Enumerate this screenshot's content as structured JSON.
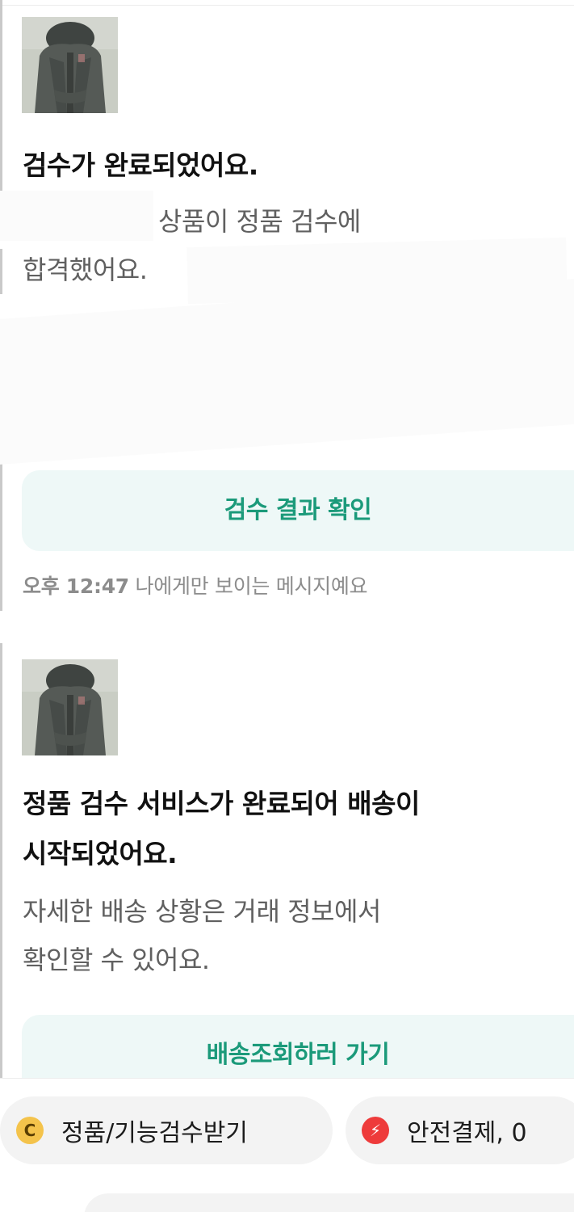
{
  "messages": [
    {
      "title": "검수가 완료되었어요.",
      "body_line1": "상품이 정품 검수에",
      "body_line2": "합격했어요.",
      "button_label": "검수 결과 확인",
      "time": "오후 12:47",
      "visibility_note": "나에게만 보이는 메시지예요"
    },
    {
      "title_line1": "정품 검수 서비스가 완료되어 배송이",
      "title_line2": "시작되었어요.",
      "body_line1": "자세한 배송 상황은 거래 정보에서",
      "body_line2": "확인할 수 있어요.",
      "button_label": "배송조회하러 가기"
    }
  ],
  "quick_actions": [
    {
      "label": "정품/기능검수받기",
      "icon": "coin-icon",
      "icon_glyph": "C"
    },
    {
      "label": "안전결제, 0",
      "icon": "lightning-icon",
      "icon_glyph": "⚡"
    }
  ],
  "colors": {
    "accent_teal": "#1b9a7a",
    "button_bg": "#eef8f7",
    "coin": "#f4c34b",
    "bolt": "#ee3b3b"
  }
}
